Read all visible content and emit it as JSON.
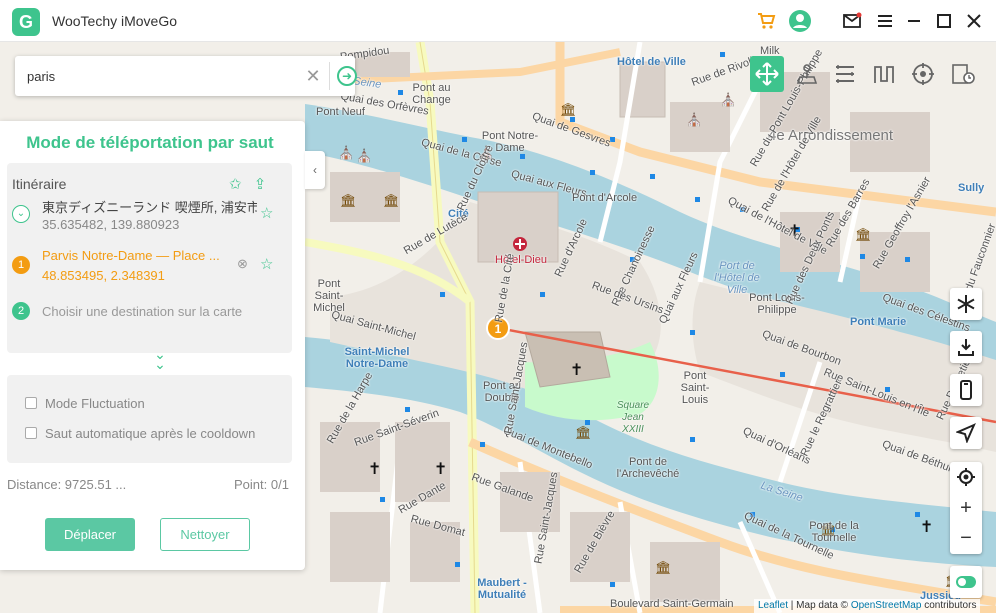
{
  "app": {
    "title": "WooTechy iMoveGo",
    "logo_letter": "G"
  },
  "titlebar_icons": [
    "cart-icon",
    "user-icon",
    "mail-icon",
    "menu-icon",
    "minimize-icon",
    "maximize-icon",
    "close-icon"
  ],
  "search": {
    "value": "paris",
    "placeholder": ""
  },
  "panel": {
    "title": "Mode de téléportation par saut",
    "itinerary_label": "Itinéraire",
    "stops": [
      {
        "badge": "",
        "name": "東京ディズニーランド 喫煙所, 浦安市...",
        "coords": "35.635482, 139.880923",
        "color": "#3ec48d"
      },
      {
        "badge": "1",
        "name": "Parvis Notre-Dame — Place ...",
        "coords": "48.853495, 2.348391",
        "color": "#f39c12"
      },
      {
        "badge": "2",
        "name": "Choisir une destination sur la carte",
        "coords": "",
        "color": "#3ec48d"
      }
    ],
    "options": {
      "fluctuation": "Mode Fluctuation",
      "auto_jump": "Saut automatique après le cooldown"
    },
    "distance": "Distance: 9725.51 ...",
    "point": "Point: 0/1",
    "move_button": "Déplacer",
    "clear_button": "Nettoyer"
  },
  "modes": [
    "teleport-jump-mode",
    "teleport-mode",
    "multi-spot-mode",
    "jump-mode",
    "joystick-mode",
    "history-mode"
  ],
  "map_labels": {
    "hotel_de_ville": "Hôtel de Ville",
    "rue_de_rivoli": "Rue de Rivoli",
    "milk": "Milk",
    "pompidou": "Pompidou",
    "pont_au_change": "Pont au Change",
    "pont_notre_dame": "Pont Notre-Dame",
    "quai_de_corse": "Quai de la Corse",
    "quai_aux_fleurs": "Quai aux Fleurs",
    "arrondissement": "4e Arrondissement",
    "cite": "Cité",
    "hotel_dieu": "Hôtel-Dieu",
    "pont_darcole": "Pont d'Arcole",
    "quai_de_lhotel_de_ville": "Quai de l'Hôtel de Ville",
    "port_hotel_de_ville": "Port de l'Hôtel de Ville",
    "pont_saint_michel": "Pont Saint-Michel",
    "saint_michel_nd": "Saint-Michel Notre-Dame",
    "pont_louis_philippe": "Pont Louis-Philippe",
    "pont_marie": "Pont Marie",
    "pont_au_double": "Pont au Double",
    "pont_saint_louis": "Pont Saint-Louis",
    "square_jean": "Square Jean XXIII",
    "quai_de_montebello": "Quai de Montebello",
    "pont_archeveche": "Pont de l'Archevêché",
    "la_seine": "La Seine",
    "pont_tournelle": "Pont de la Tournelle",
    "quai_tournelle": "Quai de la Tournelle",
    "maubert": "Maubert - Mutualité",
    "bd_saint_germain": "Boulevard Saint-Germain",
    "quai_des_orfevres": "Quai des Orfèvres",
    "rue_de_lutece": "Rue de Lutèce",
    "pont_neuf": "Pont Neuf",
    "quai_saint_michel": "Quai Saint-Michel",
    "quai_de_bourbon": "Quai de Bourbon",
    "quai_dorleans": "Quai d'Orléans",
    "quai_de_bethune": "Quai de Béthune",
    "rue_saint_louis": "Rue Saint-Louis en l'Île",
    "seine_top": "La Seine",
    "rue_de_lhotel_de_ville": "Rue de l'Hôtel de Ville",
    "rue_des_barres": "Rue des Barres",
    "rue_geoffroy": "Rue Geoffroy l'Asnier",
    "rue_du_fauconnier": "Rue du Fauconnier",
    "quai_des_celestins": "Quai des Célestins",
    "rue_dante": "Rue Dante",
    "rue_galande": "Rue Galande",
    "rue_de_la_harpe": "Rue de la Harpe",
    "rue_saint_severin": "Rue Saint-Séverin",
    "rue_domat": "Rue Domat",
    "rue_de_bievre": "Rue de Bièvre",
    "rue_du_cloitre": "Rue du Cloître",
    "rue_chanoinesse": "Rue Chanoinesse",
    "rue_darcole": "Rue d'Arcole",
    "quai_aux_fleurs_2": "Quai aux Fleurs",
    "rue_des_deux_ponts": "Rue des Deux Ponts",
    "rue_saint_jacques": "Rue Saint-Jacques",
    "quai_de_gesvres": "Quai de Gesvres",
    "rue_saint_jacques_2": "Rue Saint-Jacques",
    "sully": "Sully",
    "jussieu": "Jussieu",
    "rue_du_pont_louis": "Rue du Pont Louis-Philippe",
    "rue_poulletier": "Rue Poulletier",
    "rue_des_ursins": "Rue des Ursins",
    "rue_le_regrattier": "Rue le Regrattier",
    "rue_de_la_cite": "Rue de la Cité"
  },
  "attribution": {
    "leaflet": "Leaflet",
    "sep1": " | Map data © ",
    "osm": "OpenStreetMap",
    "contrib": " contributors"
  },
  "colors": {
    "accent": "#3ec48d",
    "orange": "#f39c12",
    "route": "#e8604a",
    "water": "#aad3df",
    "park": "#c8facc"
  },
  "route": {
    "from_marker": "1",
    "to_marker": "off-screen (right)"
  }
}
